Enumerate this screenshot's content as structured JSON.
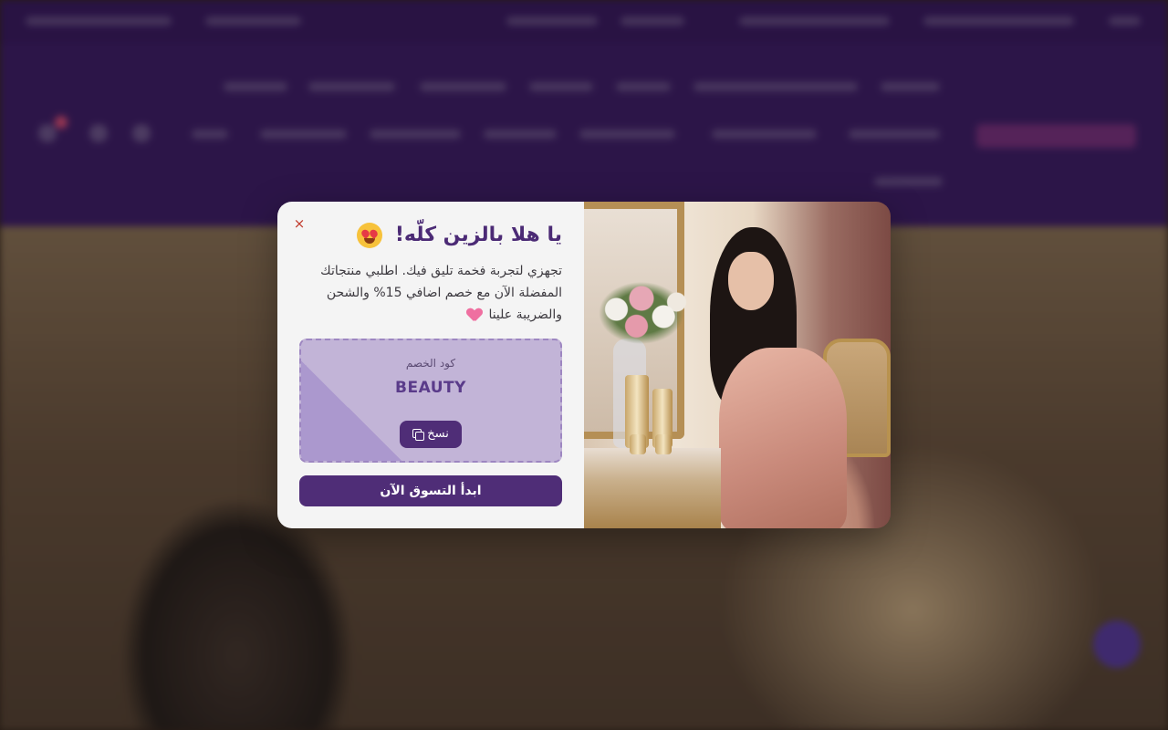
{
  "popup": {
    "close_symbol": "×",
    "title": "يا هلا بالزين كلّه!",
    "title_emoji": "smiling-face-with-heart-eyes-icon",
    "description": "تجهزي لتجربة فخمة تليق فيك. اطلبي منتجاتك المفضلة الآن مع خصم اضافي 15% والشحن والضريبة علينا",
    "description_emoji": "sparkling-heart-icon",
    "coupon": {
      "label": "كود الخصم",
      "code": "BEAUTY",
      "copy_label": "نسخ"
    },
    "cta_label": "ابدأ التسوق الآن"
  },
  "colors": {
    "brand_purple": "#4f2d77",
    "title_purple": "#4b2a75",
    "coupon_bg": "#c2b4d7",
    "header_bg": "#42206b",
    "close_red": "#c0392b"
  }
}
